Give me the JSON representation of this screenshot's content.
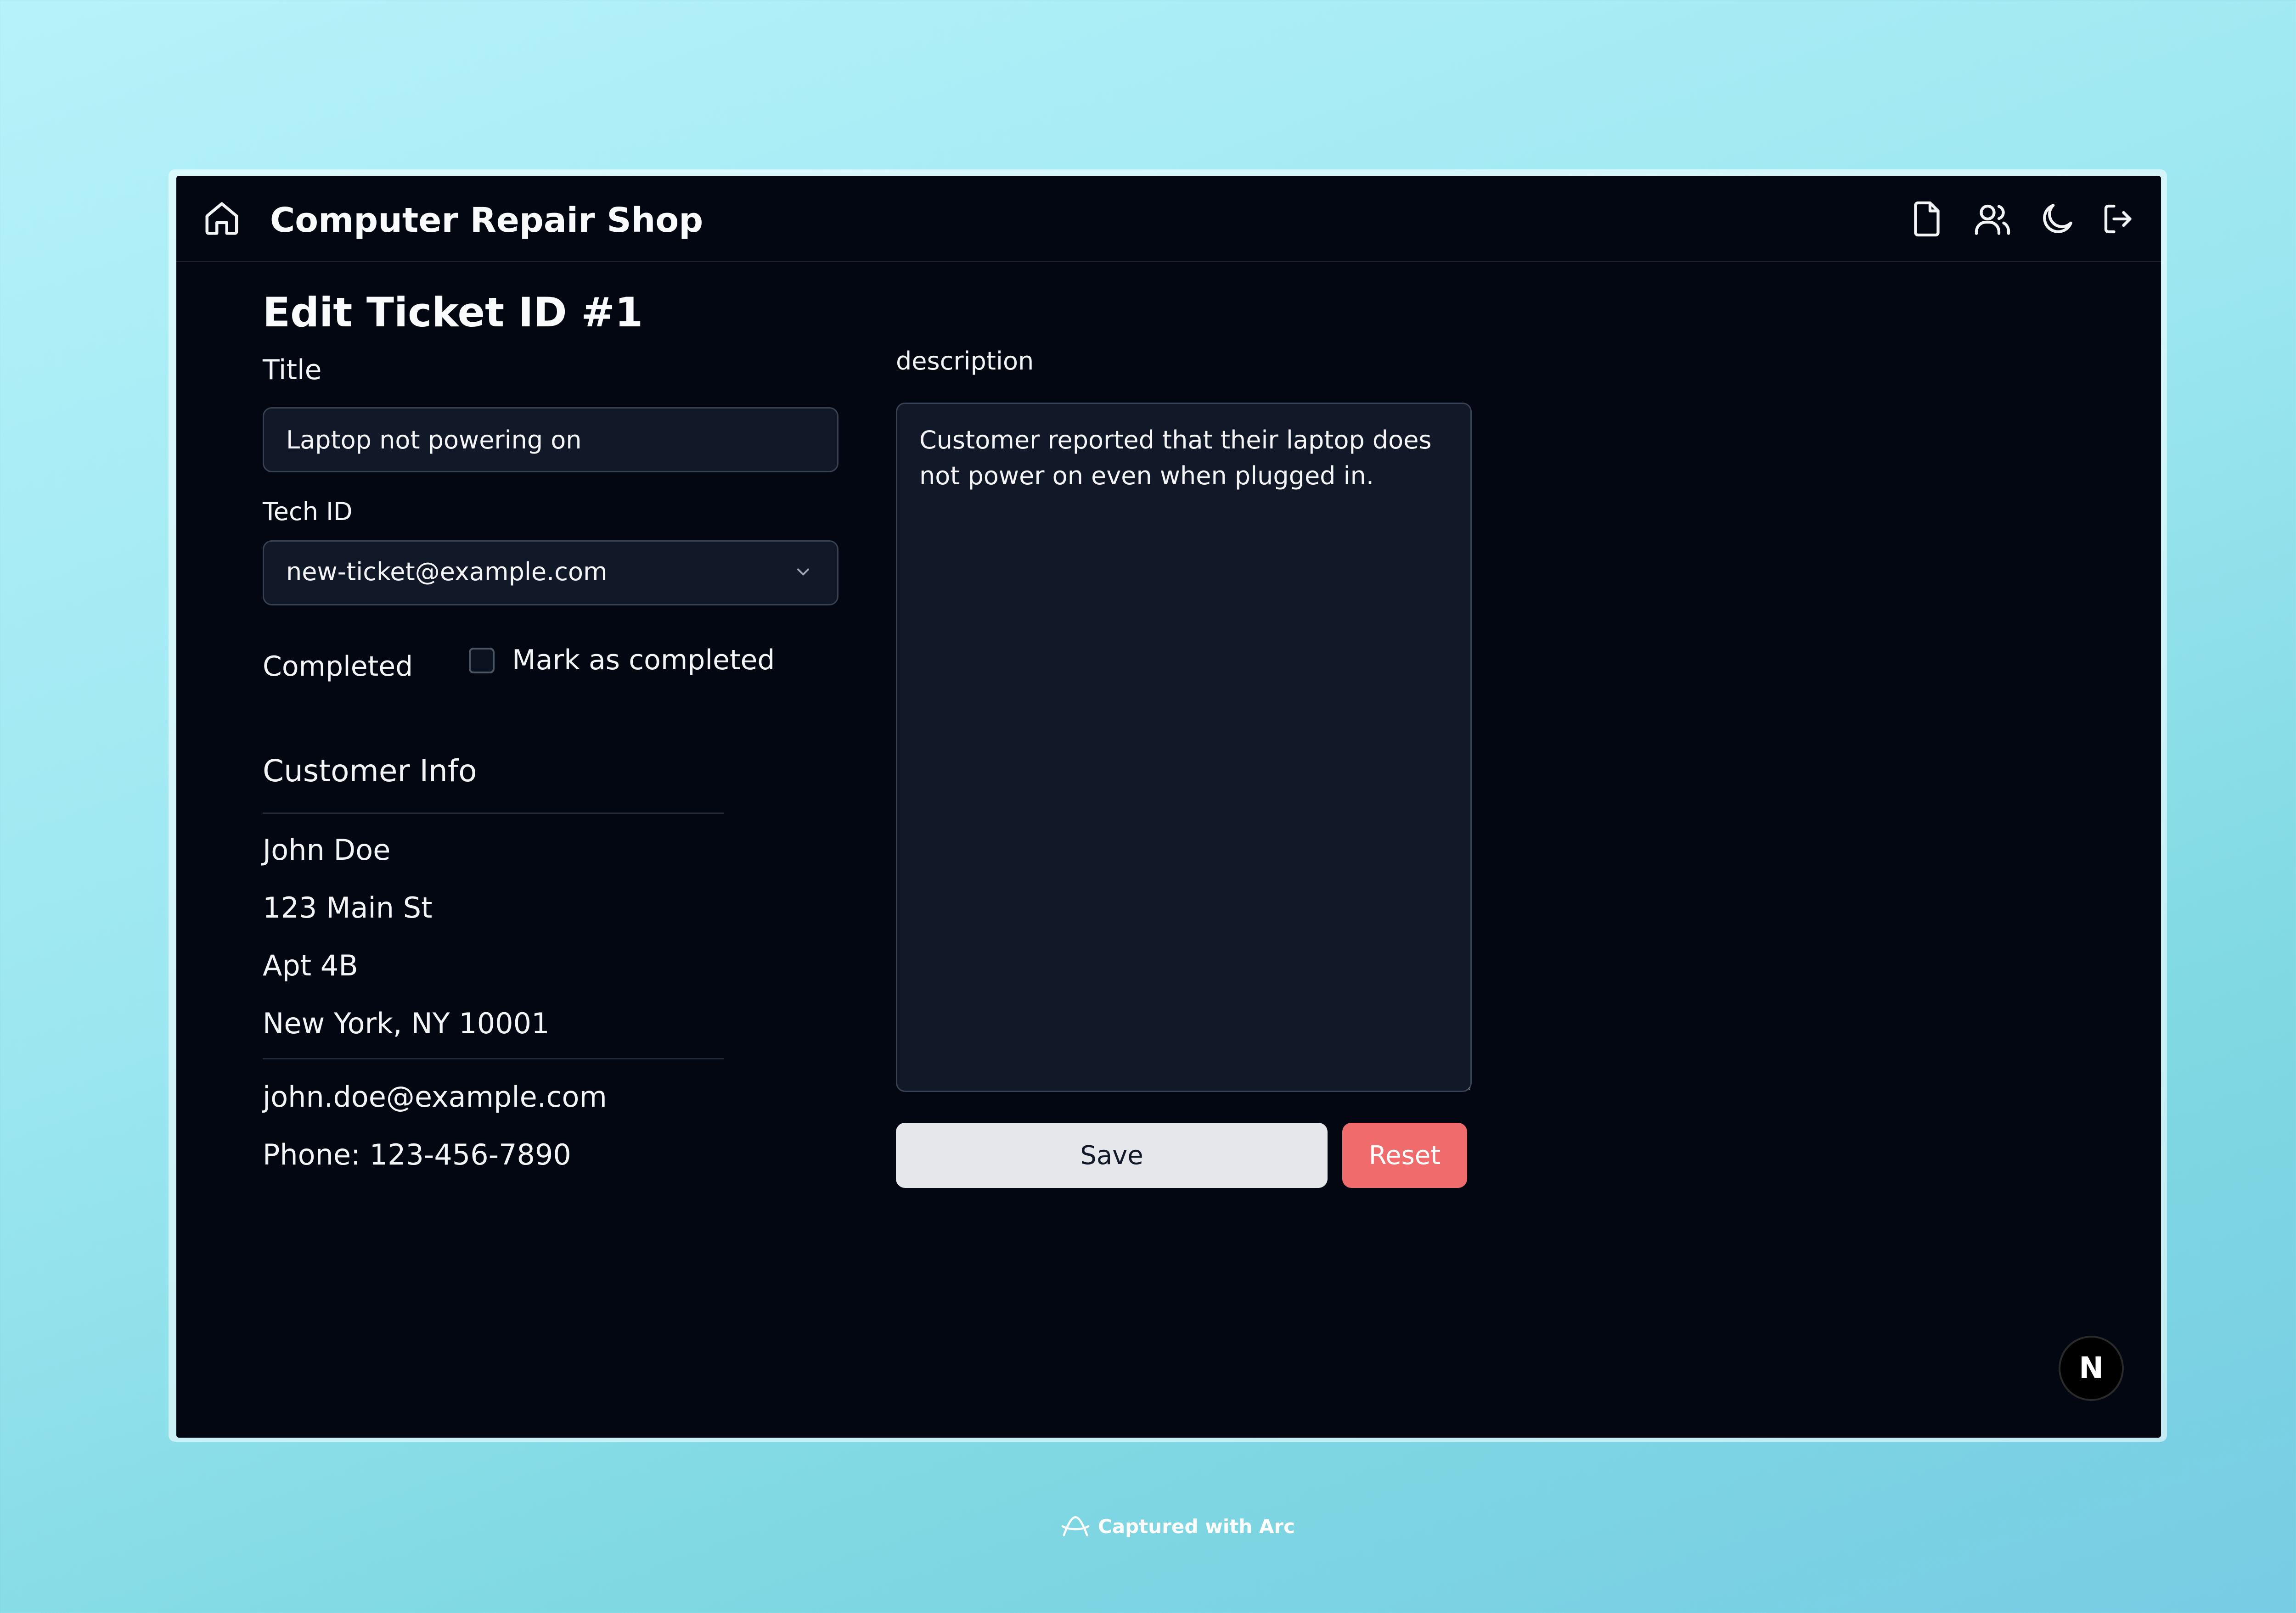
{
  "header": {
    "title": "Computer Repair Shop",
    "icons": [
      "home-icon",
      "file-icon",
      "users-icon",
      "moon-icon",
      "logout-icon"
    ]
  },
  "page": {
    "title": "Edit Ticket ID #1"
  },
  "form": {
    "title_label": "Title",
    "title_value": "Laptop not powering on",
    "tech_label": "Tech ID",
    "tech_value": "new-ticket@example.com",
    "completed_label": "Completed",
    "completed_checkbox_label": "Mark as completed",
    "completed_checked": false,
    "description_label": "description",
    "description_value": "Customer reported that their laptop does not power on even when plugged in.",
    "save_label": "Save",
    "reset_label": "Reset"
  },
  "customer": {
    "heading": "Customer Info",
    "name": "John Doe",
    "address1": "123 Main St",
    "address2": "Apt 4B",
    "city_line": "New York, NY 10001",
    "email": "john.doe@example.com",
    "phone": "Phone: 123-456-7890"
  },
  "badge": {
    "letter": "N"
  },
  "footer": {
    "text": "Captured with Arc"
  },
  "colors": {
    "app_background": "#030712",
    "input_background": "#111827",
    "save_button": "#e5e7eb",
    "reset_button": "#f06b6b"
  }
}
